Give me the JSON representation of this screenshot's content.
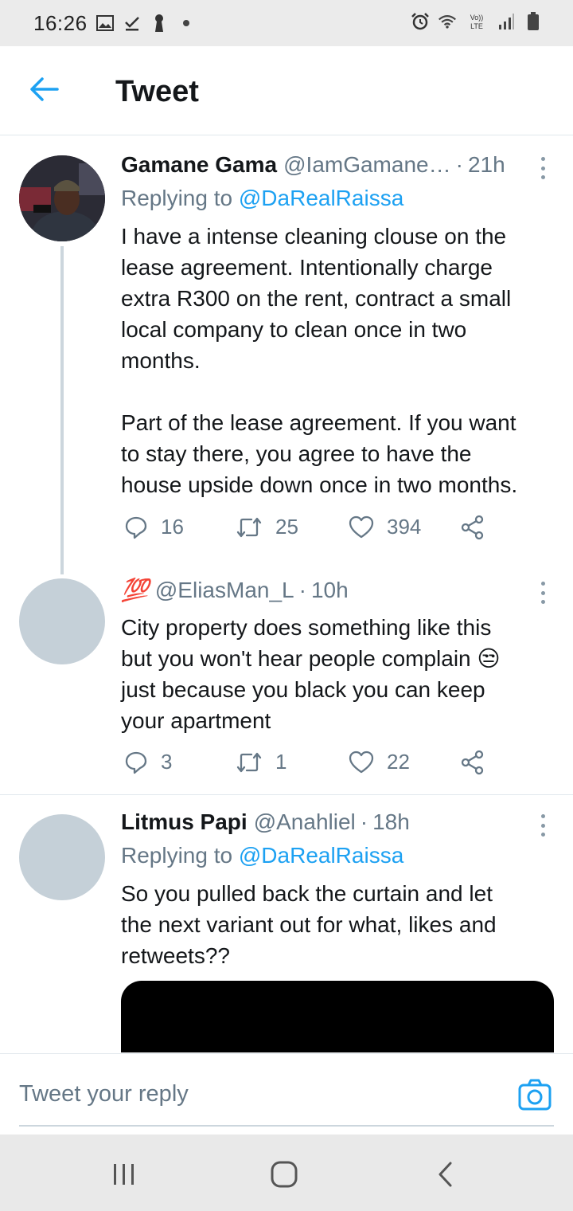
{
  "status_bar": {
    "time": "16:26",
    "left_icons": [
      "gallery-icon",
      "check-download-icon",
      "keyhole-icon",
      "dot-icon"
    ],
    "right_icons": [
      "alarm-icon",
      "wifi-icon",
      "volte-icon",
      "signal-icon",
      "battery-icon"
    ],
    "volte_label": "Vo)) LTE"
  },
  "header": {
    "back_icon": "arrow-left-icon",
    "title": "Tweet"
  },
  "colors": {
    "accent": "#1da1f2",
    "secondary_text": "#657786",
    "avatar_placeholder": "#c5d0d8"
  },
  "tweets": [
    {
      "name": "Gamane Gama",
      "handle": "@IamGamane…",
      "dot": "·",
      "time": "21h",
      "replying_prefix": "Replying to ",
      "replying_to": "@DaRealRaissa",
      "text": "I have a intense cleaning clouse on the\nlease agreement. Intentionally charge\nextra R300 on the rent, contract a small\nlocal company to clean once in two\nmonths.\n\nPart of the lease agreement. If you want\nto stay there, you agree to have the\nhouse upside down once in two months.",
      "replies": "16",
      "retweets": "25",
      "likes": "394"
    },
    {
      "name": "💯",
      "handle": "@EliasMan_L",
      "dot": "·",
      "time": "10h",
      "text": "City property does something like this\nbut you won't hear people complain 😒\njust because you black you can keep\nyour apartment",
      "replies": "3",
      "retweets": "1",
      "likes": "22"
    },
    {
      "name": "Litmus Papi",
      "handle": "@Anahliel",
      "dot": "·",
      "time": "18h",
      "replying_prefix": "Replying to ",
      "replying_to": "@DaRealRaissa",
      "text": "So you pulled back the curtain and let\nthe next variant out for what, likes and\nretweets??"
    }
  ],
  "reply_bar": {
    "placeholder": "Tweet your reply",
    "camera_icon": "camera-icon"
  },
  "nav_bar": {
    "icons": [
      "recent-apps-icon",
      "home-icon",
      "back-icon"
    ]
  }
}
